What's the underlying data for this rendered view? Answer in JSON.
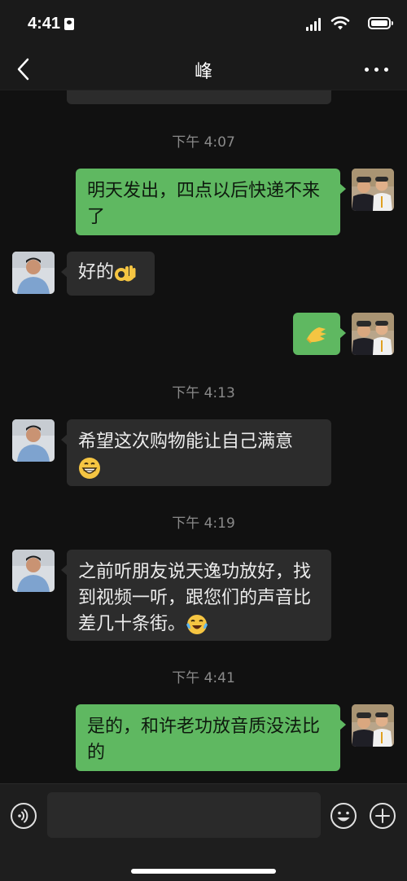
{
  "status_bar": {
    "time": "4:41"
  },
  "header": {
    "title": "峰"
  },
  "messages": [
    {
      "type": "time",
      "text": "下午 4:07"
    },
    {
      "type": "message",
      "sender": "me",
      "text": "明天发出，四点以后快递不来了"
    },
    {
      "type": "message",
      "sender": "other",
      "text": "好的",
      "emoji": "ok-hand-emoji"
    },
    {
      "type": "message",
      "sender": "me",
      "text": "",
      "emoji": "ok-hand-sign-emoji"
    },
    {
      "type": "time",
      "text": "下午 4:13"
    },
    {
      "type": "message",
      "sender": "other",
      "text": "希望这次购物能让自己满意",
      "emoji": "grinning-face-emoji"
    },
    {
      "type": "time",
      "text": "下午 4:19"
    },
    {
      "type": "message",
      "sender": "other",
      "text": "之前听朋友说天逸功放好，找到视频一听，跟您们的声音比差几十条街。",
      "emoji": "tears-of-joy-emoji"
    },
    {
      "type": "time",
      "text": "下午 4:41"
    },
    {
      "type": "message",
      "sender": "me",
      "text": "是的，和许老功放音质没法比的"
    }
  ],
  "input_bar": {
    "placeholder": ""
  },
  "colors": {
    "background": "#111111",
    "my_bubble": "#5fb861",
    "their_bubble": "#2c2c2c",
    "timestamp": "#8a8a8a"
  }
}
